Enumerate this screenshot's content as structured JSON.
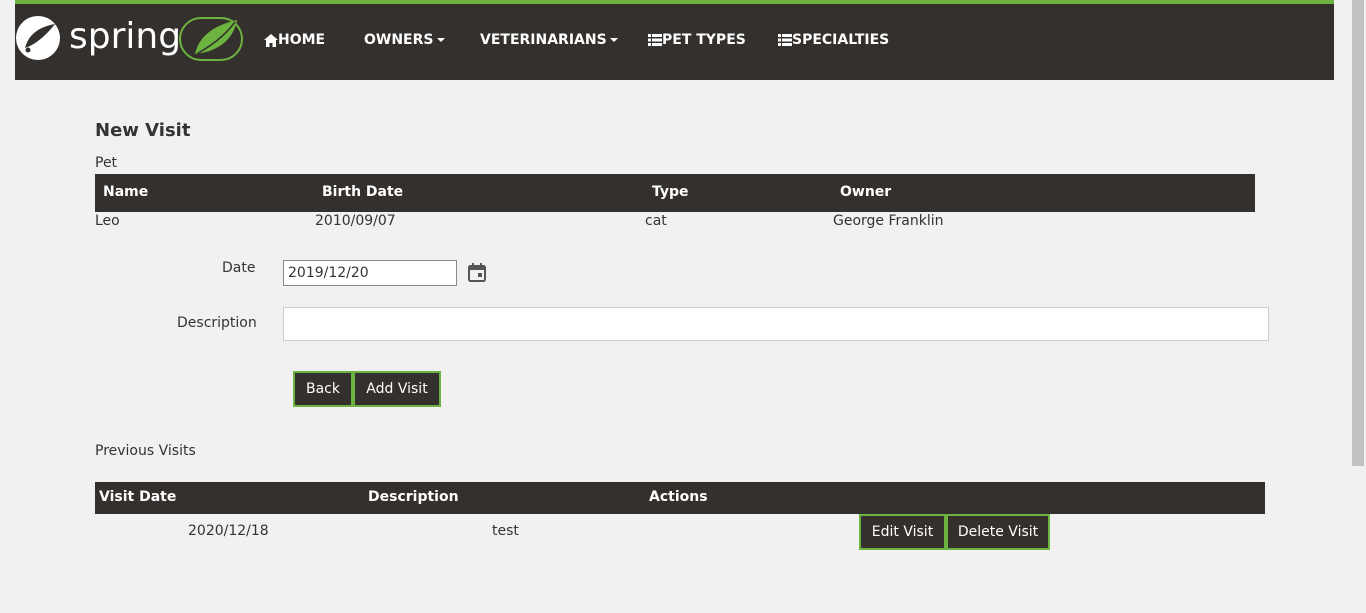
{
  "brand": {
    "logo_text": "spring"
  },
  "nav": {
    "home": "HOME",
    "owners": "OWNERS",
    "veterinarians": "VETERINARIANS",
    "pet_types": "PET TYPES",
    "specialties": "SPECIALTIES"
  },
  "page": {
    "title": "New Visit",
    "pet_section": "Pet"
  },
  "pet_table": {
    "headers": [
      "Name",
      "Birth Date",
      "Type",
      "Owner"
    ],
    "row": [
      "Leo",
      "2010/09/07",
      "cat",
      "George Franklin"
    ]
  },
  "form": {
    "date_label": "Date",
    "date_value": "2019/12/20",
    "description_label": "Description",
    "description_value": "",
    "back_label": "Back",
    "add_label": "Add Visit"
  },
  "previous": {
    "title": "Previous Visits",
    "headers": [
      "Visit Date",
      "Description",
      "Actions"
    ],
    "rows": [
      {
        "date": "2020/12/18",
        "description": "test",
        "edit_label": "Edit Visit",
        "delete_label": "Delete Visit"
      }
    ]
  },
  "colors": {
    "brand_green": "#6db33f",
    "nav_dark": "#34302d",
    "background": "#f1f1f1"
  }
}
